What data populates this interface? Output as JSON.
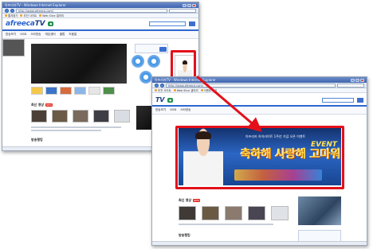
{
  "back_window": {
    "title": "아프리카TV - Windows Internet Explorer",
    "url": "http://www.afreeca.com/",
    "favorites": [
      "즐겨찾기",
      "추천 사이트",
      "Web Slice 갤러리"
    ],
    "logo": "afreeca",
    "logo_tv": "TV",
    "nav": [
      "방송보기",
      "VOD",
      "스타방송",
      "게임센터",
      "클럽",
      "도움말"
    ],
    "section_hot": "최신 영상",
    "new_badge": "NEW",
    "section_bottom": "방송랭킹"
  },
  "front_window": {
    "title": "아프리카TV - Windows Internet Explorer",
    "url": "http://www.afreeca.com/",
    "favorites": [
      "추천 사이트",
      "Web Slice 갤러리",
      "이벤트 보기"
    ],
    "logo_tv": "TV",
    "nav": [
      "방송보기",
      "VOD",
      "스타방송"
    ],
    "banner": {
      "top_text": "아프리카 하이라이트 1주년 기념 오픈 이벤트",
      "main_text": "축하해 사랑해 고마워",
      "event": "EVENT"
    },
    "section_hot": "최신 영상",
    "new_badge": "NEW",
    "section_bottom": "방송랭킹"
  },
  "colors": {
    "highlight_red": "#e3101a",
    "brand_blue": "#2b63c9"
  }
}
